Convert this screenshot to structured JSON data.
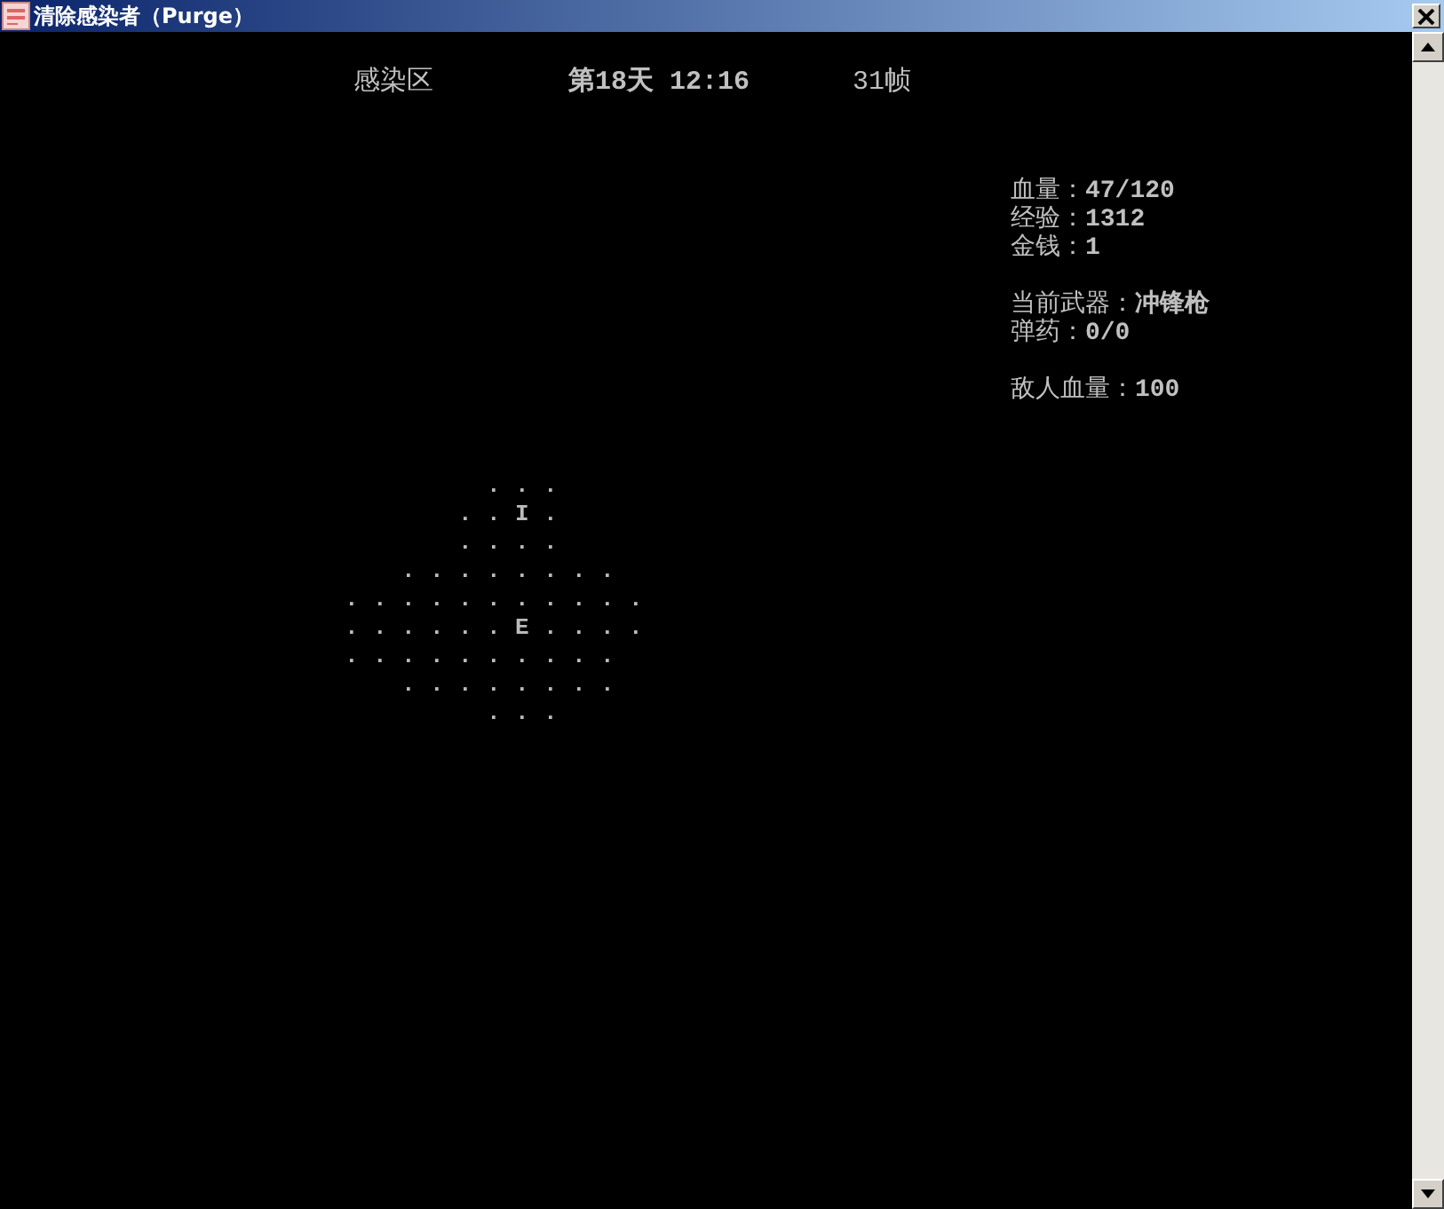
{
  "window": {
    "title": "清除感染者（Purge）"
  },
  "header": {
    "zone": "感染区",
    "day_time": "第18天 12:16",
    "fps": "31帧"
  },
  "stats": [
    [
      {
        "label": "血量：",
        "value": "47/120"
      },
      {
        "label": "经验：",
        "value": "1312"
      },
      {
        "label": "金钱：",
        "value": "1"
      }
    ],
    [
      {
        "label": "当前武器：",
        "value": "冲锋枪"
      },
      {
        "label": "弹药：",
        "value": "0/0"
      }
    ],
    [
      {
        "label": "敌人血量：",
        "value": "100"
      }
    ]
  ],
  "map": {
    "rows": [
      "     ...   ",
      "    ..I.   ",
      "    ....   ",
      "  ........ ",
      "...........",
      "......E....",
      ".......... ",
      "  ........ ",
      "     ...   "
    ]
  }
}
